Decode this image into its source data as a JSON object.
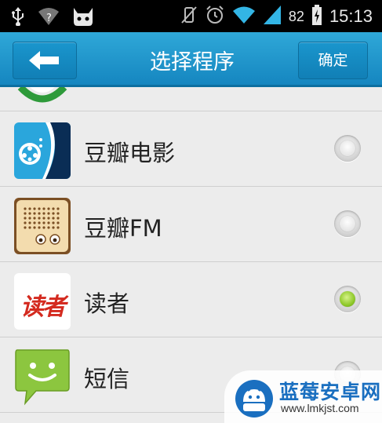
{
  "status_bar": {
    "battery_level": "82",
    "clock": "15:13",
    "icons": [
      "usb-icon",
      "wifi-unknown-icon",
      "android-debug-icon",
      "vibrate-icon",
      "alarm-icon",
      "wifi-icon",
      "signal-icon",
      "battery-charging-icon"
    ]
  },
  "action_bar": {
    "title": "选择程序",
    "back_icon": "back-arrow-icon",
    "ok_label": "确定",
    "color": "#1f9bd2"
  },
  "apps": [
    {
      "label": "豆瓣电影",
      "icon": "douban-movie-icon",
      "selected": false
    },
    {
      "label": "豆瓣FM",
      "icon": "douban-fm-icon",
      "selected": false
    },
    {
      "label": "读者",
      "icon": "duzhe-icon",
      "icon_text": "读者",
      "selected": true
    },
    {
      "label": "短信",
      "icon": "sms-icon",
      "selected": false
    }
  ],
  "watermark": {
    "title": "蓝莓安卓网",
    "url": "www.lmkjst.com"
  }
}
